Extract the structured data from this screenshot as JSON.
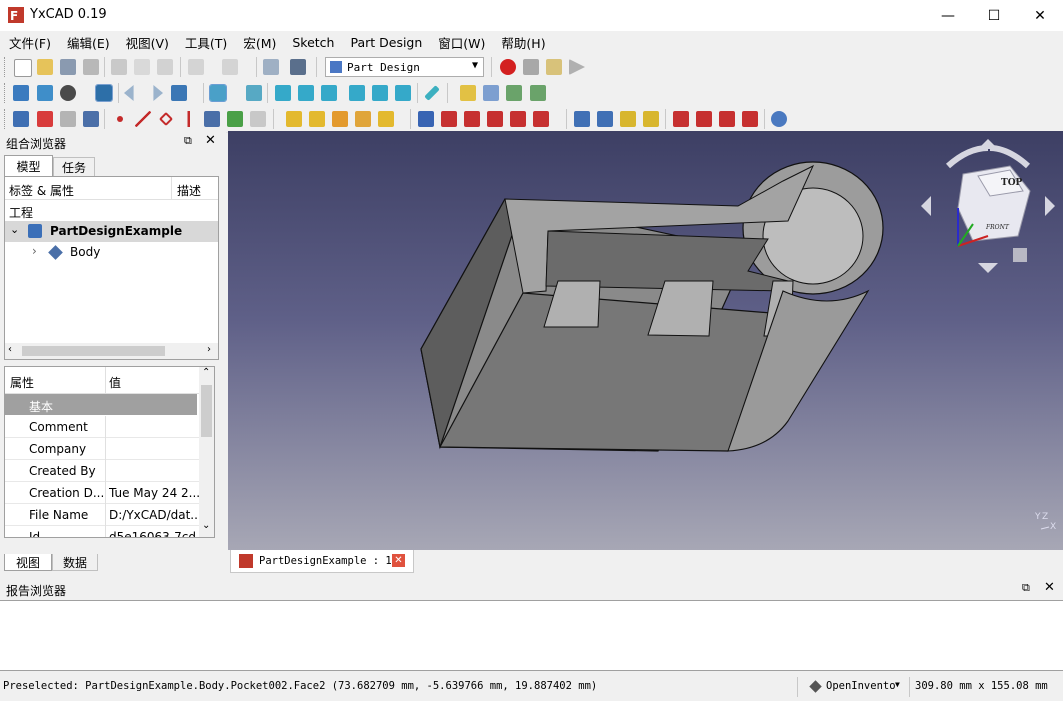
{
  "window": {
    "title": "YxCAD 0.19",
    "minimize": "—",
    "maximize": "☐",
    "close": "✕"
  },
  "menu": [
    "文件(F)",
    "编辑(E)",
    "视图(V)",
    "工具(T)",
    "宏(M)",
    "Sketch",
    "Part Design",
    "窗口(W)",
    "帮助(H)"
  ],
  "toolbar": {
    "workbench": "Part Design"
  },
  "combo_view": {
    "title": "组合浏览器",
    "tabs": [
      "模型",
      "任务"
    ],
    "tree_headers": [
      "标签 & 属性",
      "描述"
    ],
    "tree_root": "工程",
    "document": "PartDesignExample",
    "body": "Body",
    "prop_headers": [
      "属性",
      "值"
    ],
    "group": "基本",
    "properties": [
      {
        "key": "Comment",
        "value": ""
      },
      {
        "key": "Company",
        "value": ""
      },
      {
        "key": "Created By",
        "value": ""
      },
      {
        "key": "Creation D...",
        "value": "Tue May 24 2..."
      },
      {
        "key": "File Name",
        "value": "D:/YxCAD/dat..."
      },
      {
        "key": "Id",
        "value": "d5e16063-7cd"
      }
    ],
    "bottom_tabs": [
      "视图",
      "数据"
    ]
  },
  "document_tab": "PartDesignExample : 1",
  "navcube": {
    "top": "TOP",
    "front": "FRONT"
  },
  "report": {
    "title": "报告浏览器"
  },
  "status": {
    "message": "Preselected: PartDesignExample.Body.Pocket002.Face2 (73.682709 mm, -5.639766 mm, 19.887402 mm)",
    "nav_style": "OpenInvento",
    "dimensions": "309.80 mm x 155.08 mm"
  }
}
